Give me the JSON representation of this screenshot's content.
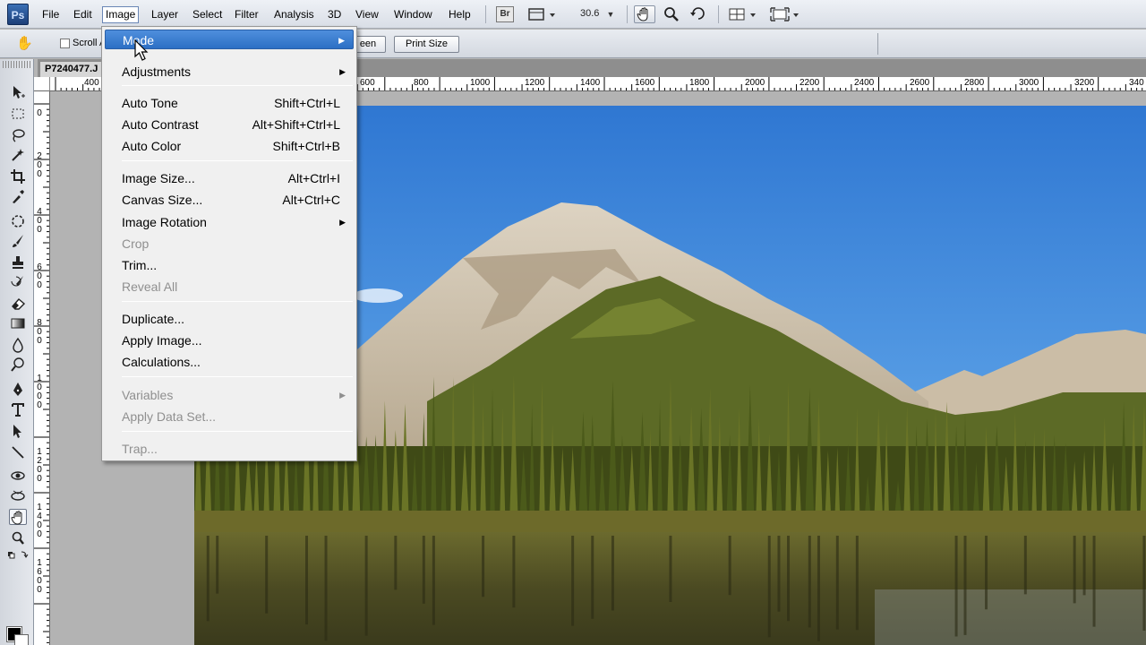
{
  "menubar": {
    "logo": "Ps",
    "items": [
      "File",
      "Edit",
      "Image",
      "Layer",
      "Select",
      "Filter",
      "Analysis",
      "3D",
      "View",
      "Window",
      "Help"
    ],
    "bridge_label": "Br",
    "zoom": "30.6",
    "zoom_arrow": "▼"
  },
  "options": {
    "scroll_label": "Scroll A",
    "screen_button": "een",
    "print_size_button": "Print Size"
  },
  "document": {
    "tab_title": "P7240477.J"
  },
  "ruler": {
    "top_ticks": [
      "400",
      "600",
      "800",
      "1000",
      "1200",
      "1400",
      "1600",
      "1800",
      "2000",
      "2200",
      "2400",
      "2600",
      "2800",
      "3000",
      "3200",
      "340"
    ],
    "left_ticks": [
      "0",
      "2 0 0",
      "4 0 0",
      "6 0 0",
      "8 0 0",
      "1 0 0 0",
      "1 2 0 0",
      "1 4 0 0",
      "1 6 0 0"
    ]
  },
  "image_menu": {
    "items": [
      {
        "label": "Mode",
        "shortcut": "",
        "submenu": true,
        "disabled": false,
        "highlight": true
      },
      {
        "label": "Adjustments",
        "shortcut": "",
        "submenu": true,
        "disabled": false
      },
      {
        "label": "Auto Tone",
        "shortcut": "Shift+Ctrl+L",
        "submenu": false,
        "disabled": false
      },
      {
        "label": "Auto Contrast",
        "shortcut": "Alt+Shift+Ctrl+L",
        "submenu": false,
        "disabled": false
      },
      {
        "label": "Auto Color",
        "shortcut": "Shift+Ctrl+B",
        "submenu": false,
        "disabled": false
      },
      {
        "label": "Image Size...",
        "shortcut": "Alt+Ctrl+I",
        "submenu": false,
        "disabled": false
      },
      {
        "label": "Canvas Size...",
        "shortcut": "Alt+Ctrl+C",
        "submenu": false,
        "disabled": false
      },
      {
        "label": "Image Rotation",
        "shortcut": "",
        "submenu": true,
        "disabled": false
      },
      {
        "label": "Crop",
        "shortcut": "",
        "submenu": false,
        "disabled": true
      },
      {
        "label": "Trim...",
        "shortcut": "",
        "submenu": false,
        "disabled": false
      },
      {
        "label": "Reveal All",
        "shortcut": "",
        "submenu": false,
        "disabled": true
      },
      {
        "label": "Duplicate...",
        "shortcut": "",
        "submenu": false,
        "disabled": false
      },
      {
        "label": "Apply Image...",
        "shortcut": "",
        "submenu": false,
        "disabled": false
      },
      {
        "label": "Calculations...",
        "shortcut": "",
        "submenu": false,
        "disabled": false
      },
      {
        "label": "Variables",
        "shortcut": "",
        "submenu": true,
        "disabled": true
      },
      {
        "label": "Apply Data Set...",
        "shortcut": "",
        "submenu": false,
        "disabled": true
      },
      {
        "label": "Trap...",
        "shortcut": "",
        "submenu": false,
        "disabled": true
      }
    ],
    "submenu_arrow": "▶"
  },
  "icons": {
    "hand": "hand-icon",
    "zoom": "zoom-icon",
    "rotate": "rotate-view-icon",
    "arrange": "arrange-documents-icon",
    "screen_mode": "screen-mode-icon",
    "view_extras": "view-extras-icon"
  },
  "colors": {
    "highlight": "#2c6fc4",
    "foreground": "#000000",
    "background": "#ffffff",
    "sky": "#3d86d8"
  }
}
